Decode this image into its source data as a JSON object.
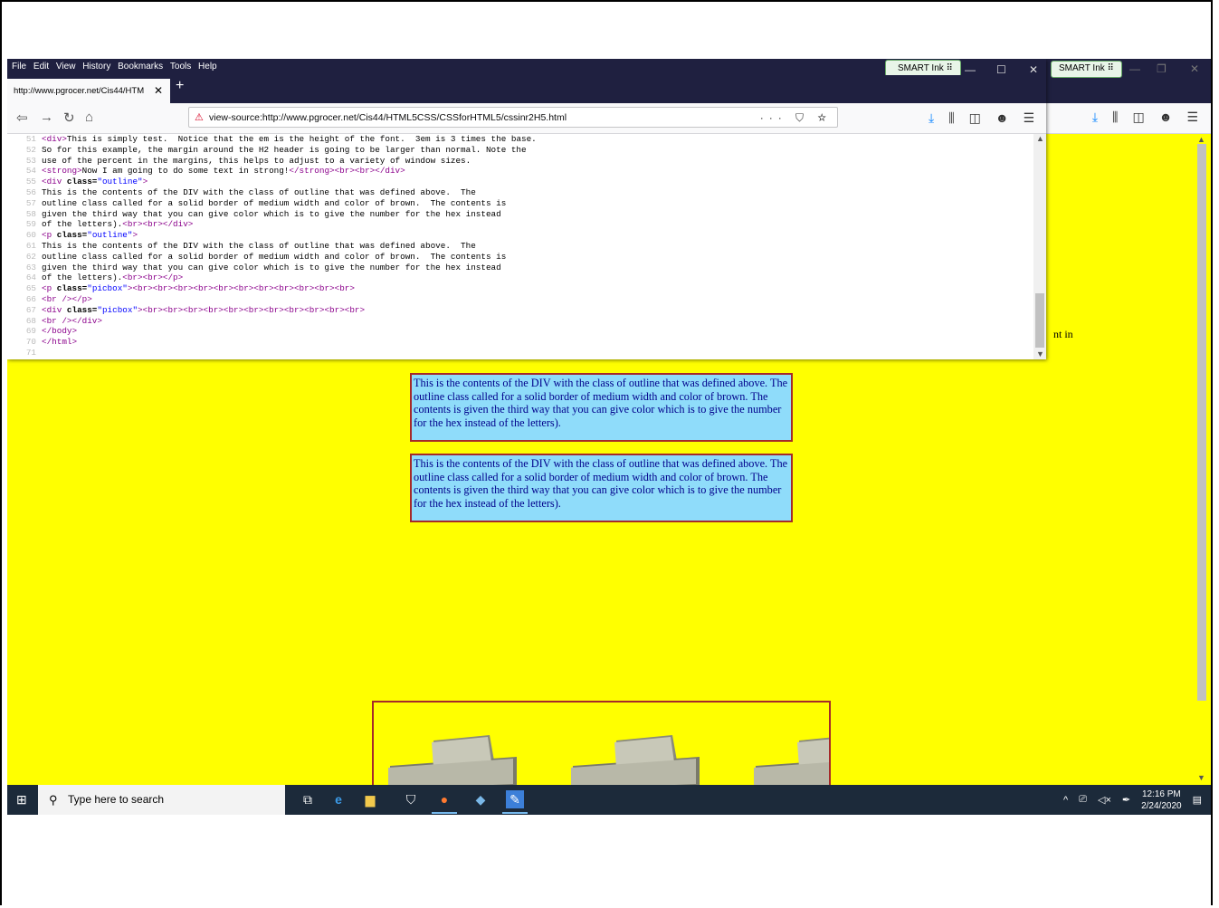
{
  "background_window": {
    "smart_ink_label": "SMART Ink",
    "toolbar_icons": [
      "download-icon",
      "library-icon",
      "sidebar-icon",
      "account-icon",
      "menu-icon"
    ],
    "partial_text": "nt in"
  },
  "menu": [
    "File",
    "Edit",
    "View",
    "History",
    "Bookmarks",
    "Tools",
    "Help"
  ],
  "smart_ink_label": "SMART Ink",
  "tab": {
    "title": "http://www.pgrocer.net/Cis44/HTM",
    "close": "✕",
    "new_tab": "+"
  },
  "url": "view-source:http://www.pgrocer.net/Cis44/HTML5CSS/CSSforHTML5/cssinr2H5.html",
  "url_actions": "··· ⛉ ☆",
  "source_lines": [
    {
      "n": "51",
      "parts": [
        [
          "t",
          "<div>"
        ],
        [
          "x",
          "This is simply test.  Notice that the em is the height of the font.  3em is 3 times the base."
        ]
      ]
    },
    {
      "n": "52",
      "parts": [
        [
          "x",
          "So for this example, the margin around the H2 header is going to be larger than normal. Note the"
        ]
      ]
    },
    {
      "n": "53",
      "parts": [
        [
          "x",
          "use of the percent in the margins, this helps to adjust to a variety of window sizes."
        ]
      ]
    },
    {
      "n": "54",
      "parts": [
        [
          "t",
          "<strong>"
        ],
        [
          "x",
          "Now I am going to do some text in strong!"
        ],
        [
          "t",
          "</strong><br><br></div>"
        ]
      ]
    },
    {
      "n": "55",
      "parts": [
        [
          "t",
          "<div "
        ],
        [
          "a",
          "class="
        ],
        [
          "v",
          "\"outline\""
        ],
        [
          "t",
          ">"
        ]
      ]
    },
    {
      "n": "56",
      "parts": [
        [
          "x",
          "This is the contents of the DIV with the class of outline that was defined above.  The"
        ]
      ]
    },
    {
      "n": "57",
      "parts": [
        [
          "x",
          "outline class called for a solid border of medium width and color of brown.  The contents is"
        ]
      ]
    },
    {
      "n": "58",
      "parts": [
        [
          "x",
          "given the third way that you can give color which is to give the number for the hex instead"
        ]
      ]
    },
    {
      "n": "59",
      "parts": [
        [
          "x",
          "of the letters)."
        ],
        [
          "t",
          "<br><br></div>"
        ]
      ]
    },
    {
      "n": "60",
      "parts": [
        [
          "t",
          "<p "
        ],
        [
          "a",
          "class="
        ],
        [
          "v",
          "\"outline\""
        ],
        [
          "t",
          ">"
        ]
      ]
    },
    {
      "n": "61",
      "parts": [
        [
          "x",
          "This is the contents of the DIV with the class of outline that was defined above.  The"
        ]
      ]
    },
    {
      "n": "62",
      "parts": [
        [
          "x",
          "outline class called for a solid border of medium width and color of brown.  The contents is"
        ]
      ]
    },
    {
      "n": "63",
      "parts": [
        [
          "x",
          "given the third way that you can give color which is to give the number for the hex instead"
        ]
      ]
    },
    {
      "n": "64",
      "parts": [
        [
          "x",
          "of the letters)."
        ],
        [
          "t",
          "<br><br></p>"
        ]
      ]
    },
    {
      "n": "65",
      "parts": [
        [
          "t",
          "<p "
        ],
        [
          "a",
          "class="
        ],
        [
          "v",
          "\"picbox\""
        ],
        [
          "t",
          "><br><br><br><br><br><br><br><br><br><br><br>"
        ]
      ]
    },
    {
      "n": "66",
      "parts": [
        [
          "t",
          "<br /></p>"
        ]
      ]
    },
    {
      "n": "67",
      "parts": [
        [
          "t",
          "<div "
        ],
        [
          "a",
          "class="
        ],
        [
          "v",
          "\"picbox\""
        ],
        [
          "t",
          "><br><br><br><br><br><br><br><br><br><br><br>"
        ]
      ]
    },
    {
      "n": "68",
      "parts": [
        [
          "t",
          "<br /></div>"
        ]
      ]
    },
    {
      "n": "69",
      "parts": [
        [
          "t",
          "</body>"
        ]
      ]
    },
    {
      "n": "70",
      "parts": [
        [
          "t",
          "</html>"
        ]
      ]
    },
    {
      "n": "71",
      "parts": []
    }
  ],
  "outline_box_1": "This is the contents of the DIV with the class of outline that was defined above. The outline class called for a solid border of medium width and color of brown. The contents is given the third way that you can give color which is to give the number for the hex instead of the letters).",
  "outline_box_2": "This is the contents of the DIV with the class of outline that was defined above. The outline class called for a solid border of medium width and color of brown. The contents is given the third way that you can give color which is to give the number for the hex instead of the letters).",
  "taskbar": {
    "search_placeholder": "Type here to search",
    "time": "12:16 PM",
    "date": "2/24/2020"
  },
  "colors": {
    "page_bg": "#ffff00",
    "outline_bg": "#8fdcfa",
    "outline_border": "#a52a2a",
    "text": "#00008b",
    "chrome_dark": "#1f2040"
  }
}
